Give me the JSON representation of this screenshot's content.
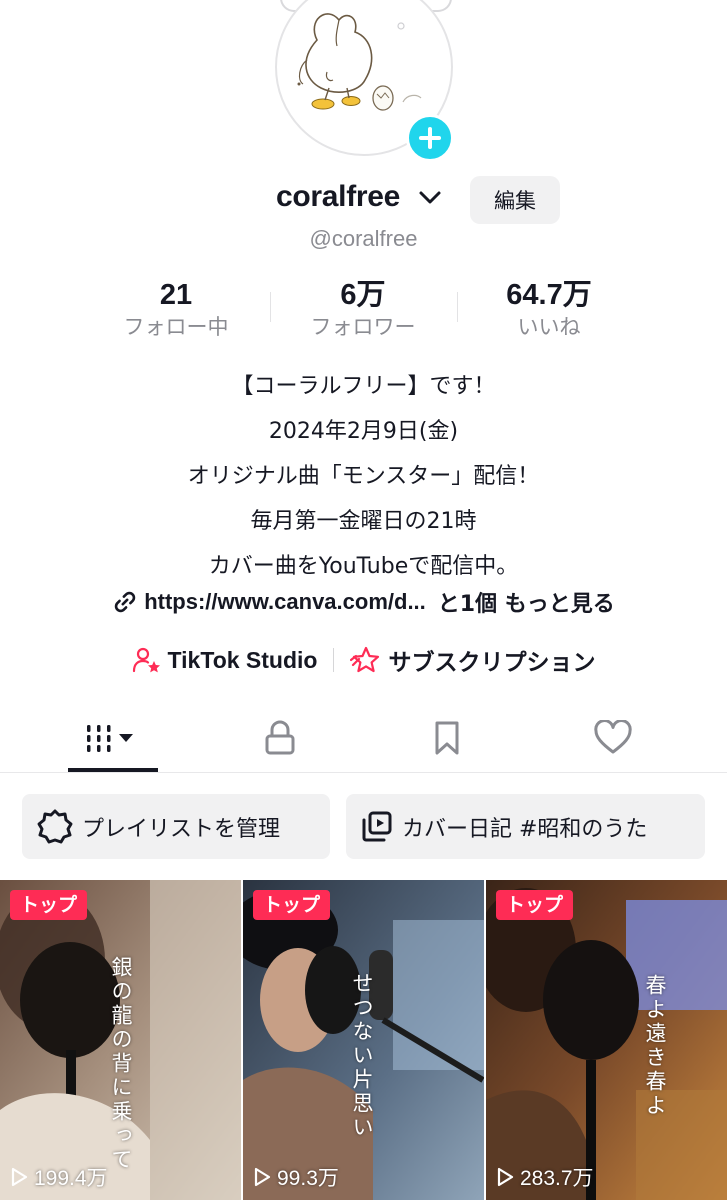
{
  "profile": {
    "username": "coralfree",
    "handle": "@coralfree",
    "edit_label": "編集"
  },
  "stats": [
    {
      "value": "21",
      "label": "フォロー中"
    },
    {
      "value": "6万",
      "label": "フォロワー"
    },
    {
      "value": "64.7万",
      "label": "いいね"
    }
  ],
  "bio": {
    "lines": [
      "【コーラルフリー】です！",
      "2024年2月9日(金)",
      "オリジナル曲「モンスター」配信！",
      "毎月第一金曜日の21時",
      "カバー曲をYouTubeで配信中。"
    ],
    "link_url": "https://www.canva.com/d...",
    "link_more": "と1個 もっと見る"
  },
  "quick_links": {
    "studio": "TikTok Studio",
    "subscription": "サブスクリプション"
  },
  "playlists": {
    "manage": "プレイリストを管理",
    "cover_diary": "カバー日記 #昭和のうた"
  },
  "videos": [
    {
      "badge": "トップ",
      "caption": "銀の龍の背に乗って",
      "views": "199.4万"
    },
    {
      "badge": "トップ",
      "caption": "せつない片思い",
      "views": "99.3万"
    },
    {
      "badge": "トップ",
      "caption": "春よ遠き春よ",
      "views": "283.7万"
    }
  ],
  "colors": {
    "accent_pink": "#fe2c55",
    "follow_badge": "#20d5ec",
    "text_primary": "#161823",
    "text_secondary": "#8a8b91"
  },
  "icons": {
    "tab_videos": "grid-icon",
    "tab_private": "lock-icon",
    "tab_saved": "bookmark-icon",
    "tab_liked": "heart-icon"
  }
}
